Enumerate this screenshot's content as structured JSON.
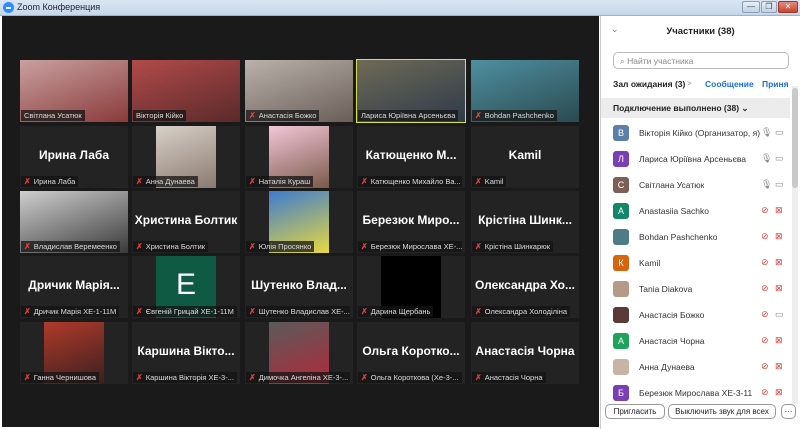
{
  "window": {
    "title": "Zoom Конференция",
    "min": "—",
    "restore": "❐",
    "close": "✕"
  },
  "gallery": {
    "tiles": [
      {
        "label": "Світлана Усатюк",
        "muted": false,
        "type": "video",
        "c1": "#c9a0a0",
        "c2": "#8a3a3a"
      },
      {
        "label": "Вікторія Кійко",
        "muted": false,
        "type": "video",
        "c1": "#b24a4a",
        "c2": "#5a2a2a"
      },
      {
        "label": "Анастасія Божко",
        "muted": true,
        "type": "video",
        "c1": "#b9b2aa",
        "c2": "#6a5e58"
      },
      {
        "label": "Лариса Юріївна Арсеньєва",
        "muted": false,
        "type": "video",
        "active": true,
        "c1": "#6e6a56",
        "c2": "#2e3a4a"
      },
      {
        "label": "Bohdan Pashchenko",
        "muted": true,
        "type": "video",
        "c1": "#4f8fa0",
        "c2": "#2a4a50"
      },
      {
        "label": "Ирина Лаба",
        "big": "Ирина Лаба",
        "muted": true,
        "type": "name"
      },
      {
        "label": "Анна Дунаева",
        "muted": true,
        "type": "photo",
        "c1": "#d8d0c8",
        "c2": "#8a7a70"
      },
      {
        "label": "Наталія Кураш",
        "muted": true,
        "type": "photo",
        "c1": "#f3c6d8",
        "c2": "#7a5a4a"
      },
      {
        "label": "Катющенко Михайло Ва...",
        "big": "Катющенко  М...",
        "muted": true,
        "type": "name"
      },
      {
        "label": "Kamil",
        "big": "Kamil",
        "muted": true,
        "type": "name"
      },
      {
        "label": "Владислав Веремеенко",
        "muted": true,
        "type": "video",
        "c1": "#cfcfcf",
        "c2": "#3a3a3a"
      },
      {
        "label": "Христина Болтик",
        "big": "Христина Болтик",
        "muted": true,
        "type": "name"
      },
      {
        "label": "Юлія Просянко",
        "muted": true,
        "type": "photo",
        "c1": "#3c7bd0",
        "c2": "#e8d840"
      },
      {
        "label": "Березюк Мирослава ХЕ-...",
        "big": "Березюк  Миро...",
        "muted": true,
        "type": "name"
      },
      {
        "label": "Крістіна Шинкарюк",
        "big": "Крістіна  Шинк...",
        "muted": true,
        "type": "name"
      },
      {
        "label": "Дричик Марія ХЕ-1-11М",
        "big": "Дричик  Марія...",
        "muted": true,
        "type": "name"
      },
      {
        "label": "Євгеній Грицай ХЕ-1-11М",
        "letter": "E",
        "muted": true,
        "type": "letter"
      },
      {
        "label": "Шутенко Владислав ХЕ-...",
        "big": "Шутенко  Влад...",
        "muted": true,
        "type": "name"
      },
      {
        "label": "Дарина Щербань",
        "muted": true,
        "type": "photo",
        "c1": "#000000",
        "c2": "#000000"
      },
      {
        "label": "Олександра Холоділіна",
        "big": "Олександра  Хо...",
        "muted": true,
        "type": "name"
      },
      {
        "label": "Ганна Чернишова",
        "muted": true,
        "type": "photo",
        "c1": "#b03a2a",
        "c2": "#3a2020"
      },
      {
        "label": "Каршина Вікторія ХЕ-3-...",
        "big": "Каршина  Вікто...",
        "muted": true,
        "type": "name"
      },
      {
        "label": "Димочка Ангеліна ХЕ-3-...",
        "muted": true,
        "type": "photo",
        "c1": "#5a5a5a",
        "c2": "#b02a3a"
      },
      {
        "label": "Ольга Короткова (Хе-3-...",
        "big": "Ольга  Коротко...",
        "muted": true,
        "type": "name"
      },
      {
        "label": "Анастасія Чорна",
        "big": "Анастасія Чорна",
        "muted": true,
        "type": "name"
      }
    ]
  },
  "panel": {
    "title": "Участники (38)",
    "search_placeholder": "Найти участника",
    "waiting": "Зал ожидания (3)",
    "waiting_arrow": ">",
    "message": "Сообщение",
    "admit": "Приня",
    "group": "Подключение выполнено (38)  ⌄",
    "collapse": "⌄",
    "participants": [
      {
        "name": "Вікторія Кійко (Организатор, я)",
        "letter": "В",
        "color": "#5b7fa6",
        "mic": "on",
        "cam": "on"
      },
      {
        "name": "Лариса Юріївна Арсеньєва",
        "letter": "Л",
        "color": "#7b3fb5",
        "mic": "on",
        "cam": "on"
      },
      {
        "name": "Світлана Усатюк",
        "letter": "С",
        "color": "#7d5f55",
        "mic": "on",
        "cam": "on"
      },
      {
        "name": "Anastasiia Sachko",
        "letter": "A",
        "color": "#14876a",
        "mic": "off",
        "cam": "off"
      },
      {
        "name": "Bohdan Pashchenko",
        "letter": "",
        "color": "#4d7b86",
        "mic": "off",
        "cam": "off"
      },
      {
        "name": "Kamil",
        "letter": "К",
        "color": "#d9640e",
        "mic": "off",
        "cam": "off"
      },
      {
        "name": "Tania Diakova",
        "letter": "",
        "color": "#b59a88",
        "mic": "off",
        "cam": "off"
      },
      {
        "name": "Анастасія Божко",
        "letter": "",
        "color": "#5a3a36",
        "mic": "off",
        "cam": "on"
      },
      {
        "name": "Анастасія Чорна",
        "letter": "A",
        "color": "#1ea45a",
        "mic": "off",
        "cam": "off"
      },
      {
        "name": "Анна Дунаева",
        "letter": "",
        "color": "#c9b4a4",
        "mic": "off",
        "cam": "off"
      },
      {
        "name": "Березюк Мирослава ХЕ-3-11",
        "letter": "Б",
        "color": "#7b3fb5",
        "mic": "off",
        "cam": "off"
      }
    ],
    "invite": "Пригласить",
    "mute_all": "Выключить звук для всех",
    "more": "···"
  }
}
